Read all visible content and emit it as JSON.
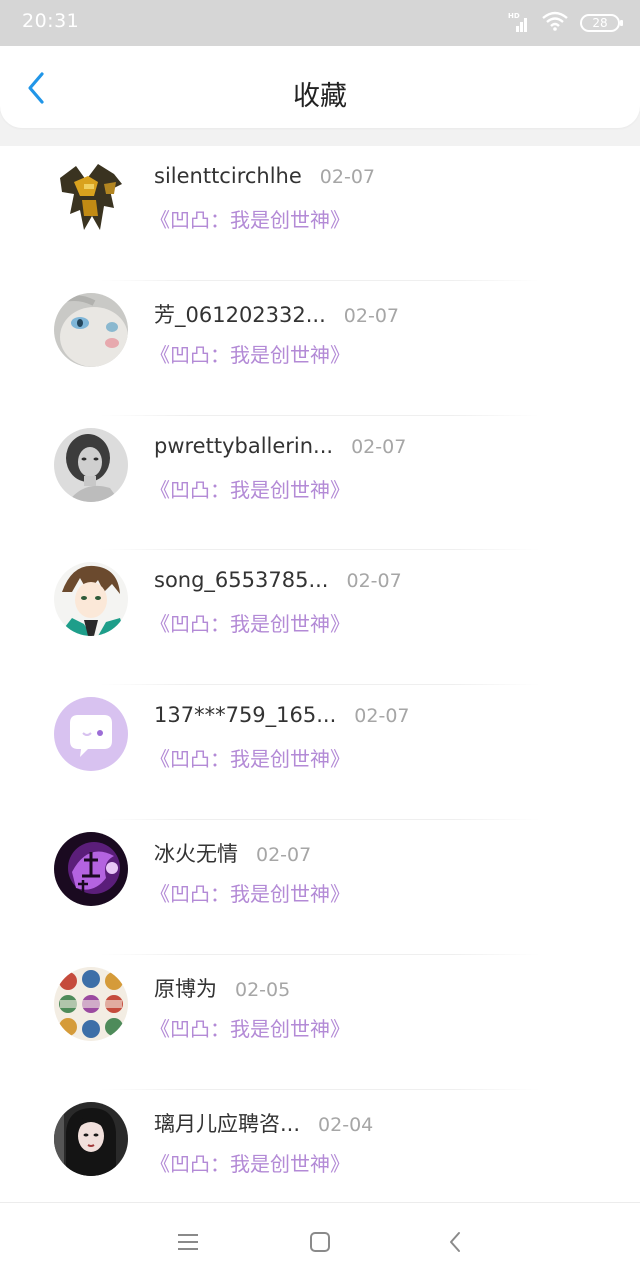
{
  "status_bar": {
    "time": "20:31",
    "network_badge": "HD",
    "battery": "28"
  },
  "header": {
    "title": "收藏",
    "back_icon": "chevron-left-icon"
  },
  "items": [
    {
      "name": "silenttcirchlhe",
      "date": "02-07",
      "book": "《凹凸：我是创世神》",
      "avatar": "robot-avatar"
    },
    {
      "name": "芳_061202332...",
      "date": "02-07",
      "book": "《凹凸：我是创世神》",
      "avatar": "cat-avatar"
    },
    {
      "name": "pwrettyballerin...",
      "date": "02-07",
      "book": "《凹凸：我是创世神》",
      "avatar": "woman-avatar"
    },
    {
      "name": "song_6553785...",
      "date": "02-07",
      "book": "《凹凸：我是创世神》",
      "avatar": "anime-avatar"
    },
    {
      "name": "137***759_165...",
      "date": "02-07",
      "book": "《凹凸：我是创世神》",
      "avatar": "chat-bubble-avatar"
    },
    {
      "name": "冰火无情",
      "date": "02-07",
      "book": "《凹凸：我是创世神》",
      "avatar": "purple-calligraphy-avatar"
    },
    {
      "name": "原博为",
      "date": "02-05",
      "book": "《凹凸：我是创世神》",
      "avatar": "collage-avatar"
    },
    {
      "name": "璃月儿应聘咨...",
      "date": "02-04",
      "book": "《凹凸：我是创世神》",
      "avatar": "dark-girl-avatar"
    }
  ],
  "nav": {
    "menu_icon": "menu-icon",
    "home_icon": "home-square-icon",
    "back_icon": "back-triangle-icon"
  },
  "colors": {
    "book_title": "#b38ad6",
    "back_accent": "#2196e8",
    "date": "#a6a6a6"
  }
}
